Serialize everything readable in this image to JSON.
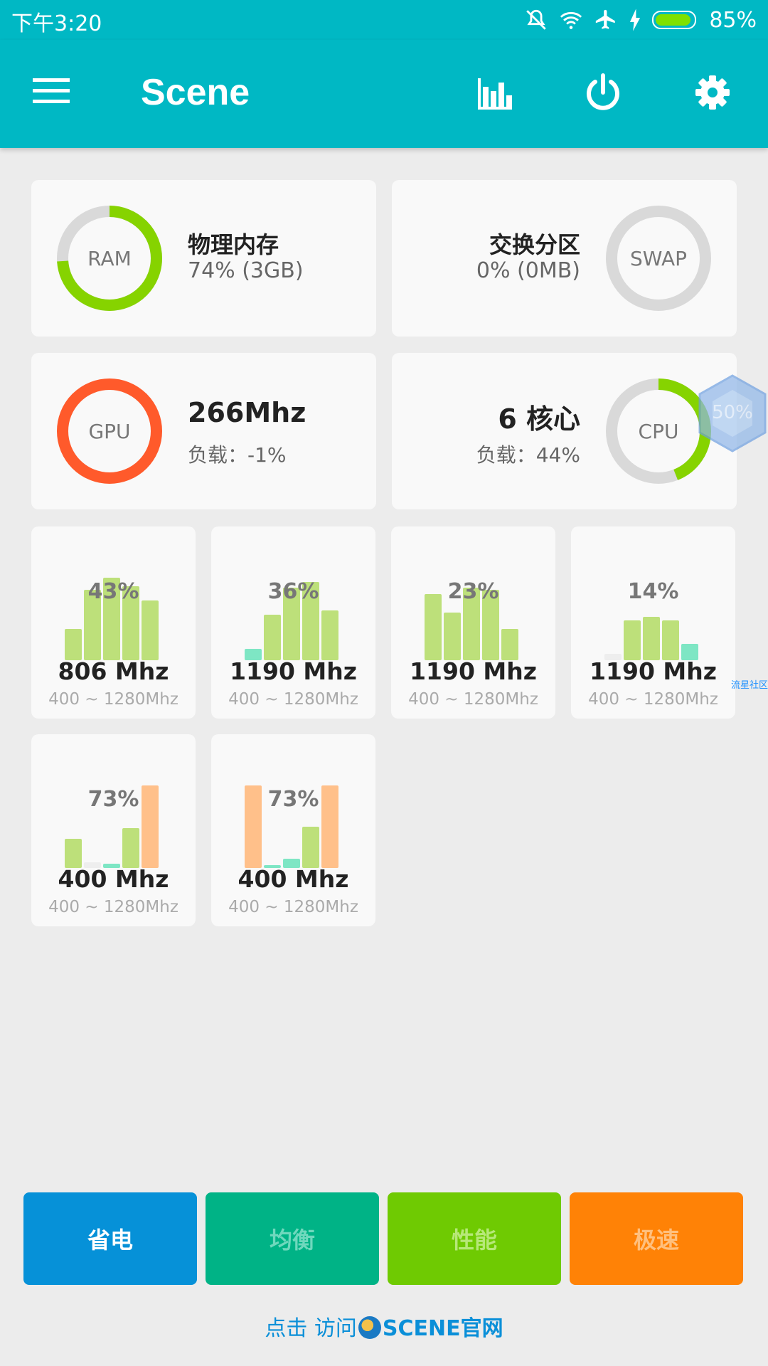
{
  "status_bar": {
    "time": "下午3:20",
    "battery": "85%",
    "icons": [
      "mute-icon",
      "wifi-icon",
      "airplane-icon",
      "charging-icon",
      "battery-icon"
    ]
  },
  "app_bar": {
    "title": "Scene",
    "actions": [
      "bar-chart-icon",
      "power-icon",
      "gear-icon"
    ]
  },
  "memory": {
    "ram": {
      "ring_label": "RAM",
      "title": "物理内存",
      "value": "74% (3GB)",
      "percent": 74
    },
    "swap": {
      "ring_label": "SWAP",
      "title": "交换分区",
      "value": "0% (0MB)",
      "percent": 0
    }
  },
  "gpu": {
    "ring_label": "GPU",
    "freq": "266Mhz",
    "load": "负载：-1%",
    "percent": 100
  },
  "cpu": {
    "ring_label": "CPU",
    "cores": "6 核心",
    "load": "负载：44%",
    "percent": 44
  },
  "cores": [
    {
      "percent_label": "43%",
      "freq": "806 Mhz",
      "range": "400 ~ 1280Mhz",
      "bars": [
        0.38,
        0.85,
        1.0,
        0.9,
        0.72
      ],
      "colors": [
        "green",
        "green",
        "green",
        "green",
        "green"
      ]
    },
    {
      "percent_label": "36%",
      "freq": "1190 Mhz",
      "range": "400 ~ 1280Mhz",
      "bars": [
        0.14,
        0.55,
        0.88,
        0.95,
        0.6
      ],
      "colors": [
        "teal",
        "green",
        "green",
        "green",
        "green"
      ]
    },
    {
      "percent_label": "23%",
      "freq": "1190 Mhz",
      "range": "400 ~ 1280Mhz",
      "bars": [
        0.8,
        0.58,
        0.88,
        0.85,
        0.38
      ],
      "colors": [
        "green",
        "green",
        "green",
        "green",
        "green"
      ]
    },
    {
      "percent_label": "14%",
      "freq": "1190 Mhz",
      "range": "400 ~ 1280Mhz",
      "bars": [
        0.08,
        0.48,
        0.53,
        0.48,
        0.2
      ],
      "colors": [
        "gray",
        "green",
        "green",
        "green",
        "teal"
      ]
    },
    {
      "percent_label": "73%",
      "freq": "400 Mhz",
      "range": "400 ~ 1280Mhz",
      "bars": [
        0.35,
        0.07,
        0.05,
        0.48,
        1.0
      ],
      "colors": [
        "green",
        "gray",
        "teal",
        "green",
        "orange"
      ]
    },
    {
      "percent_label": "73%",
      "freq": "400 Mhz",
      "range": "400 ~ 1280Mhz",
      "bars": [
        1.0,
        0.03,
        0.11,
        0.5,
        1.0
      ],
      "colors": [
        "orange",
        "teal",
        "teal",
        "green",
        "orange"
      ]
    }
  ],
  "modes": [
    {
      "label": "省电",
      "bg": "#0691d8",
      "fg": "#ffffff"
    },
    {
      "label": "均衡",
      "bg": "#00b386",
      "fg": "#6fd8bd"
    },
    {
      "label": "性能",
      "bg": "#6fca02",
      "fg": "#b7e879"
    },
    {
      "label": "极速",
      "bg": "#ff8206",
      "fg": "#ffc07e"
    }
  ],
  "footer": {
    "prefix": "点击 访问",
    "suffix": "SCENE官网"
  },
  "floating_widget": {
    "label": "50%"
  },
  "edge_label": "流星社区",
  "colors": {
    "accent": "#00b8c4",
    "ram_green": "#86d300",
    "gpu_orange": "#ff5a2b",
    "ring_gray": "#d9d9d9",
    "bar_green": "#bde07a",
    "bar_teal": "#7ee6c4",
    "bar_orange": "#ffc08a",
    "bar_gray": "#eeeeee"
  }
}
